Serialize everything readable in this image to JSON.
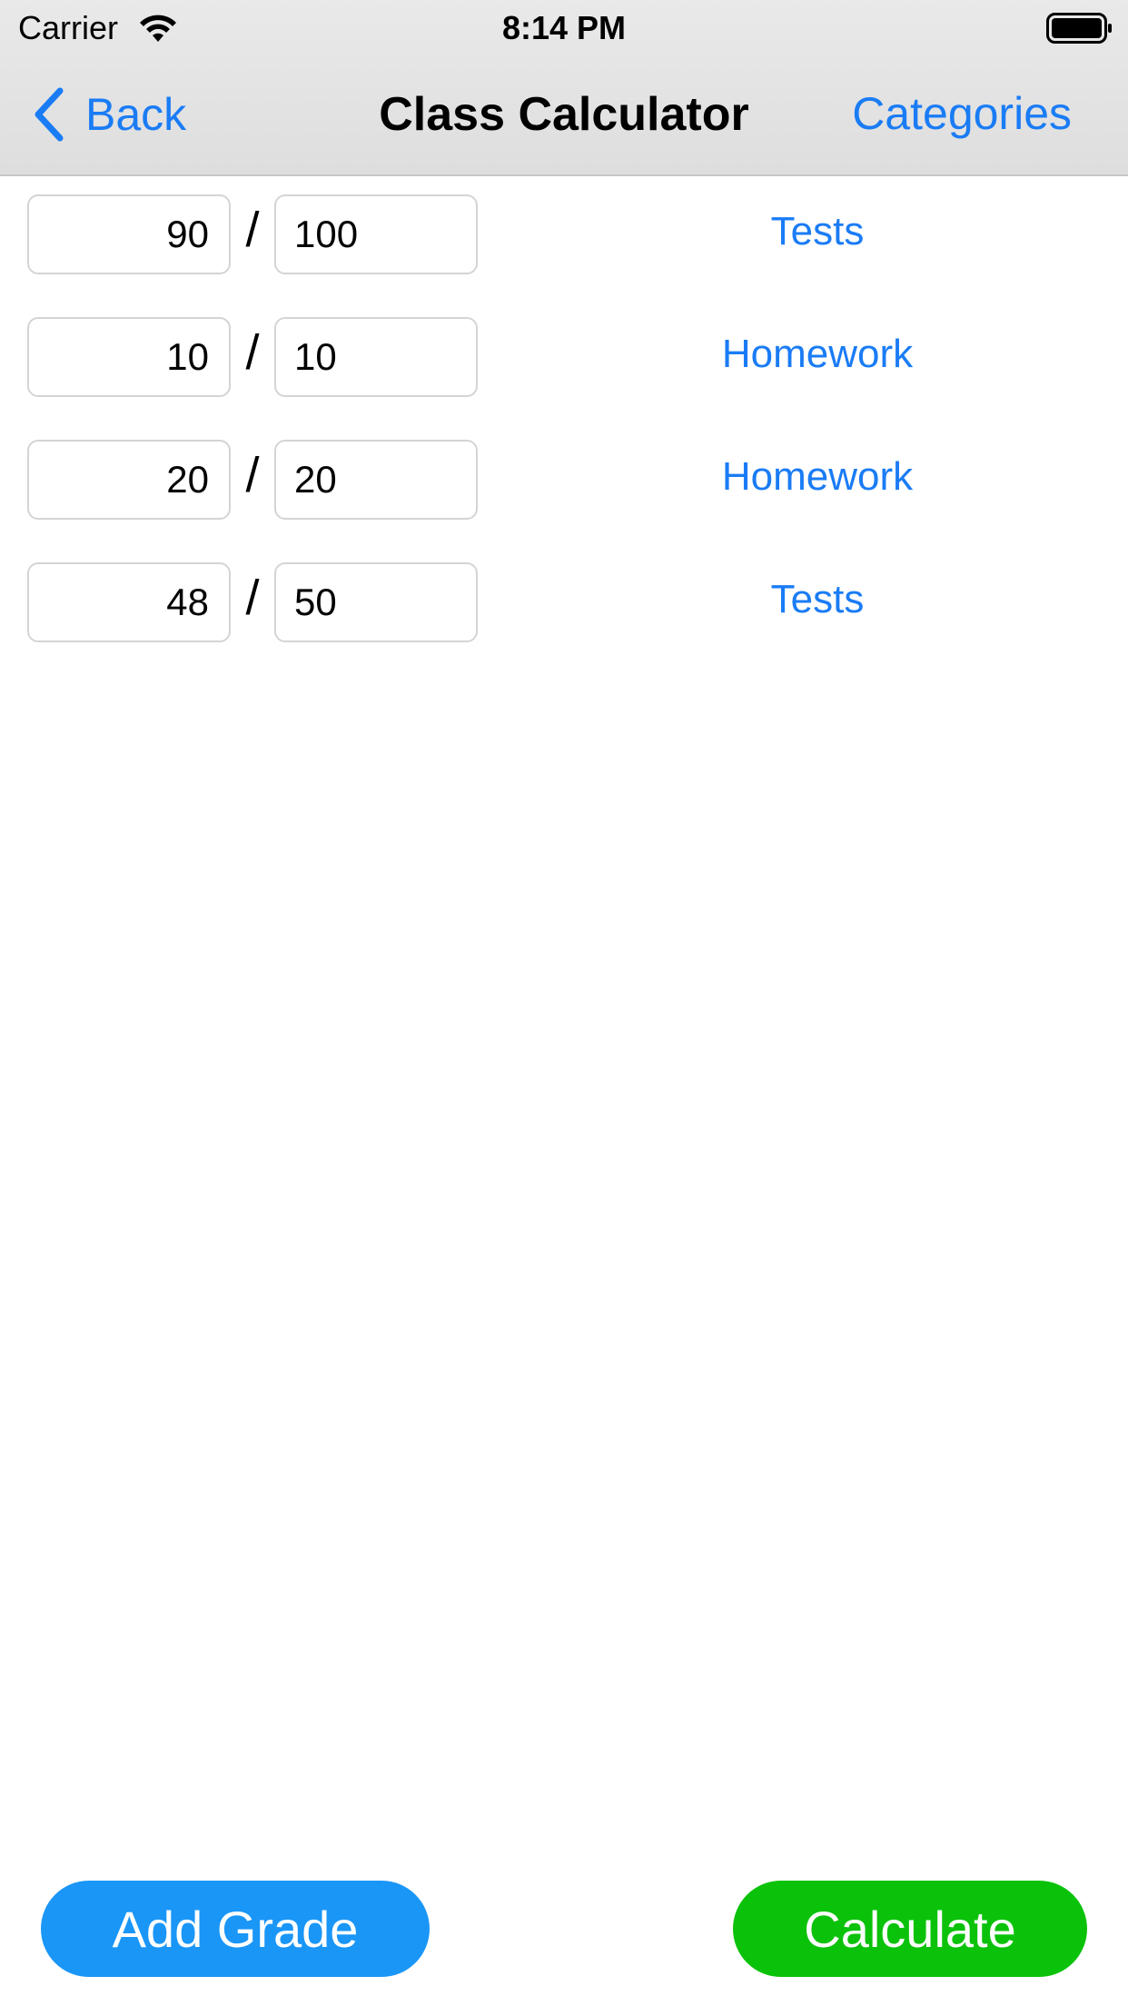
{
  "status_bar": {
    "carrier": "Carrier",
    "time": "8:14 PM",
    "wifi_icon": "wifi-icon",
    "battery_icon": "battery-icon"
  },
  "nav": {
    "back_label": "Back",
    "back_icon": "chevron-left-icon",
    "title": "Class Calculator",
    "right_button": "Categories"
  },
  "grades": [
    {
      "earned": "90",
      "separator": "/",
      "total": "100",
      "category": "Tests"
    },
    {
      "earned": "10",
      "separator": "/",
      "total": "10",
      "category": "Homework"
    },
    {
      "earned": "20",
      "separator": "/",
      "total": "20",
      "category": "Homework"
    },
    {
      "earned": "48",
      "separator": "/",
      "total": "50",
      "category": "Tests"
    }
  ],
  "actions": {
    "add_grade": "Add Grade",
    "calculate": "Calculate"
  },
  "colors": {
    "accent": "#1a7cf5",
    "add_button": "#1a96f7",
    "calculate_button": "#0bc20b",
    "header_bg": "#e3e3e3"
  }
}
